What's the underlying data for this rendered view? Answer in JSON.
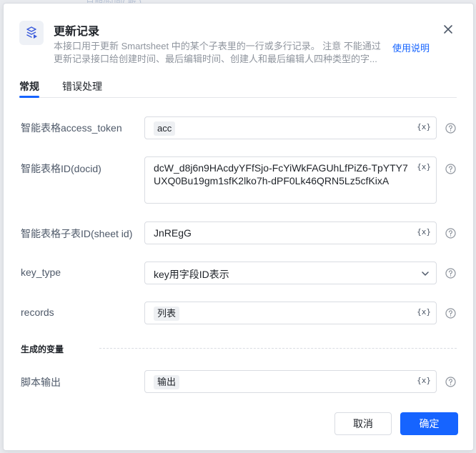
{
  "backdrop": {
    "text": "日期/时间(  新  )"
  },
  "dialog": {
    "title": "更新记录",
    "description_line1": "本接口用于更新 Smartsheet 中的某个子表里的一行或多行记录。 注意 不能通过",
    "description_line2": "更新记录接口给创建时间、最后编辑时间、创建人和最后编辑人四种类型的字...",
    "help_link": "使用说明",
    "icons": {
      "header": "smartsheet-icon",
      "close": "close-icon"
    }
  },
  "tabs": [
    {
      "label": "常规",
      "active": true
    },
    {
      "label": "错误处理",
      "active": false
    }
  ],
  "fields": {
    "access_token": {
      "label": "智能表格access_token",
      "value": "acc"
    },
    "docid": {
      "label": "智能表格ID(docid)",
      "value": "dcW_d8j6n9HAcdyYFfSjo-FcYiWkFAGUhLfPiZ6-TpYTY7UXQ0Bu19gm1sfK2lko7h-dPF0Lk46QRN5Lz5cfKixA"
    },
    "sheet_id": {
      "label": "智能表格子表ID(sheet id)",
      "value": "JnREgG"
    },
    "key_type": {
      "label": "key_type",
      "value": "key用字段ID表示"
    },
    "records": {
      "label": "records",
      "value": "列表"
    },
    "script_output": {
      "label": "脚本输出",
      "value": "输出"
    }
  },
  "variable_button": "{x}",
  "section": {
    "generated_vars": "生成的变量"
  },
  "buttons": {
    "cancel": "取消",
    "confirm": "确定"
  },
  "colors": {
    "accent": "#1664ff",
    "label": "#4e5969",
    "border": "#d9dce2"
  }
}
